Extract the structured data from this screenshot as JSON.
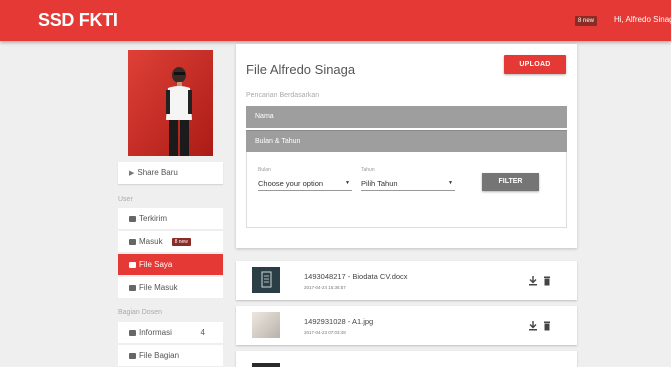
{
  "navbar": {
    "brand": "SSD FKTI",
    "notif_badge": "8 new",
    "greeting": "Hi, Alfredo Sinaga"
  },
  "sidebar": {
    "share_label": "Share Baru",
    "section_user": "User",
    "section_dosen": "Bagian Dosen",
    "user_items": [
      {
        "label": "Terkirim",
        "icon": "inbox-icon"
      },
      {
        "label": "Masuk",
        "icon": "inbox-icon",
        "badge": "8 new"
      },
      {
        "label": "File Saya",
        "icon": "files-icon",
        "active": true
      },
      {
        "label": "File Masuk",
        "icon": "files-icon"
      }
    ],
    "dosen_items": [
      {
        "label": "Informasi",
        "icon": "inbox-icon",
        "count": "4"
      },
      {
        "label": "File Bagian",
        "icon": "files-icon"
      }
    ]
  },
  "main": {
    "title": "File Alfredo Sinaga",
    "upload_label": "UPLOAD",
    "search_label": "Pencarian Berdasarkan",
    "accordion": [
      "Nama",
      "Bulan & Tahun"
    ],
    "filter": {
      "bulan_label": "Bulan",
      "bulan_value": "Choose your option",
      "tahun_label": "Tahun",
      "tahun_value": "Pilih Tahun",
      "button": "FILTER"
    }
  },
  "files": [
    {
      "name": "1493048217 - Biodata CV.docx",
      "date": "2017-04-24 15:36:57",
      "thumb": "document-icon"
    },
    {
      "name": "1492931028 - A1.jpg",
      "date": "2017-04-23 07:03:48",
      "thumb": "image-thumbnail"
    }
  ],
  "colors": {
    "primary": "#e53935",
    "badge": "#8a2b26",
    "accordion": "#9e9e9e",
    "filter_button": "#757575"
  }
}
